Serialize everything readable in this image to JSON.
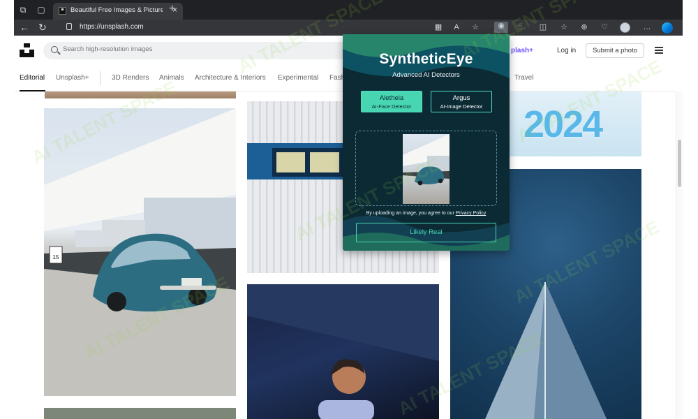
{
  "browser": {
    "tab_title": "Beautiful Free Images & Pictures",
    "tab_close": "×",
    "new_tab": "+",
    "url": "https://unsplash.com"
  },
  "site": {
    "search_placeholder": "Search high-resolution images",
    "unsplash_plus": "plash+",
    "login": "Log in",
    "submit": "Submit a photo",
    "categories": [
      "Editorial",
      "Unsplash+",
      "3D Renders",
      "Animals",
      "Architecture & Interiors",
      "Experimental",
      "Fash",
      "Travel"
    ]
  },
  "extension": {
    "title": "SyntheticEye",
    "subtitle": "Advanced AI Detectors",
    "modes": [
      {
        "name": "Aletheia",
        "description": "AI-Face Detector",
        "active": true
      },
      {
        "name": "Argus",
        "description": "AI-Image Detector",
        "active": false
      }
    ],
    "consent_prefix": "By uploading an image, you agree to our",
    "privacy_link": "Privacy Policy",
    "result": "Likely Real"
  },
  "images": {
    "year_text": "2024",
    "sign_text": "15"
  },
  "watermark": "AI TALENT SPACE",
  "colors": {
    "accent": "#48d6b2",
    "popup_bg": "#0b2a34",
    "browser_dark": "#202124"
  }
}
